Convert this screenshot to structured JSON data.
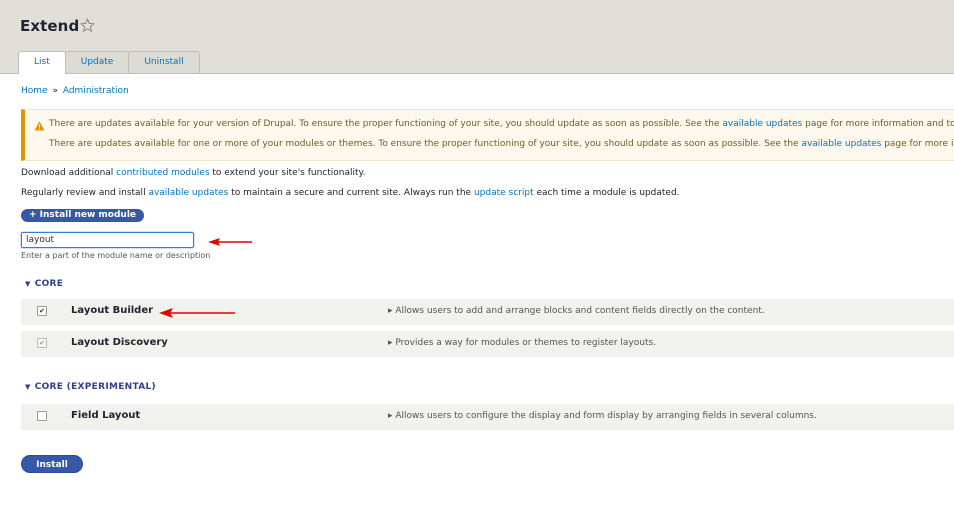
{
  "header": {
    "title": "Extend",
    "tabs": [
      {
        "label": "List",
        "active": true
      },
      {
        "label": "Update",
        "active": false
      },
      {
        "label": "Uninstall",
        "active": false
      }
    ]
  },
  "breadcrumb": {
    "items": [
      "Home",
      "Administration"
    ],
    "separator": "»"
  },
  "warning": {
    "line1_prefix": "There are updates available for your version of Drupal. To ensure the proper functioning of your site, you should update as soon as possible. See the ",
    "line1_link": "available updates",
    "line1_suffix": " page for more information and to install y",
    "line2_prefix": "There are updates available for one or more of your modules or themes. To ensure the proper functioning of your site, you should update as soon as possible. See the ",
    "line2_link": "available updates",
    "line2_suffix": " page for more informat",
    "color": "#e09600"
  },
  "intro": {
    "p1_prefix": "Download additional ",
    "p1_link": "contributed modules",
    "p1_suffix": " to extend your site's functionality.",
    "p2_prefix": "Regularly review and install ",
    "p2_link1": "available updates",
    "p2_middle": " to maintain a secure and current site. Always run the ",
    "p2_link2": "update script",
    "p2_suffix": " each time a module is updated."
  },
  "install_new_label": "+ Install new module",
  "filter": {
    "value": "layout",
    "description": "Enter a part of the module name or description"
  },
  "groups": [
    {
      "title": "CORE",
      "modules": [
        {
          "name": "Layout Builder",
          "checked": true,
          "description": "Allows users to add and arrange blocks and content fields directly on the content."
        },
        {
          "name": "Layout Discovery",
          "checked": true,
          "disabled": true,
          "description": "Provides a way for modules or themes to register layouts."
        }
      ]
    },
    {
      "title": "CORE (EXPERIMENTAL)",
      "modules": [
        {
          "name": "Field Layout",
          "checked": false,
          "description": "Allows users to configure the display and form display by arranging fields in several columns."
        }
      ]
    }
  ],
  "install_label": "Install",
  "icons": {
    "star": "star-outline-icon",
    "warning": "warning-triangle-icon",
    "caret": "caret-down-icon",
    "arrow": "red-annotation-arrow"
  },
  "colors": {
    "accent": "#3757a8",
    "link": "#0074bd",
    "annotation": "#e00000"
  }
}
